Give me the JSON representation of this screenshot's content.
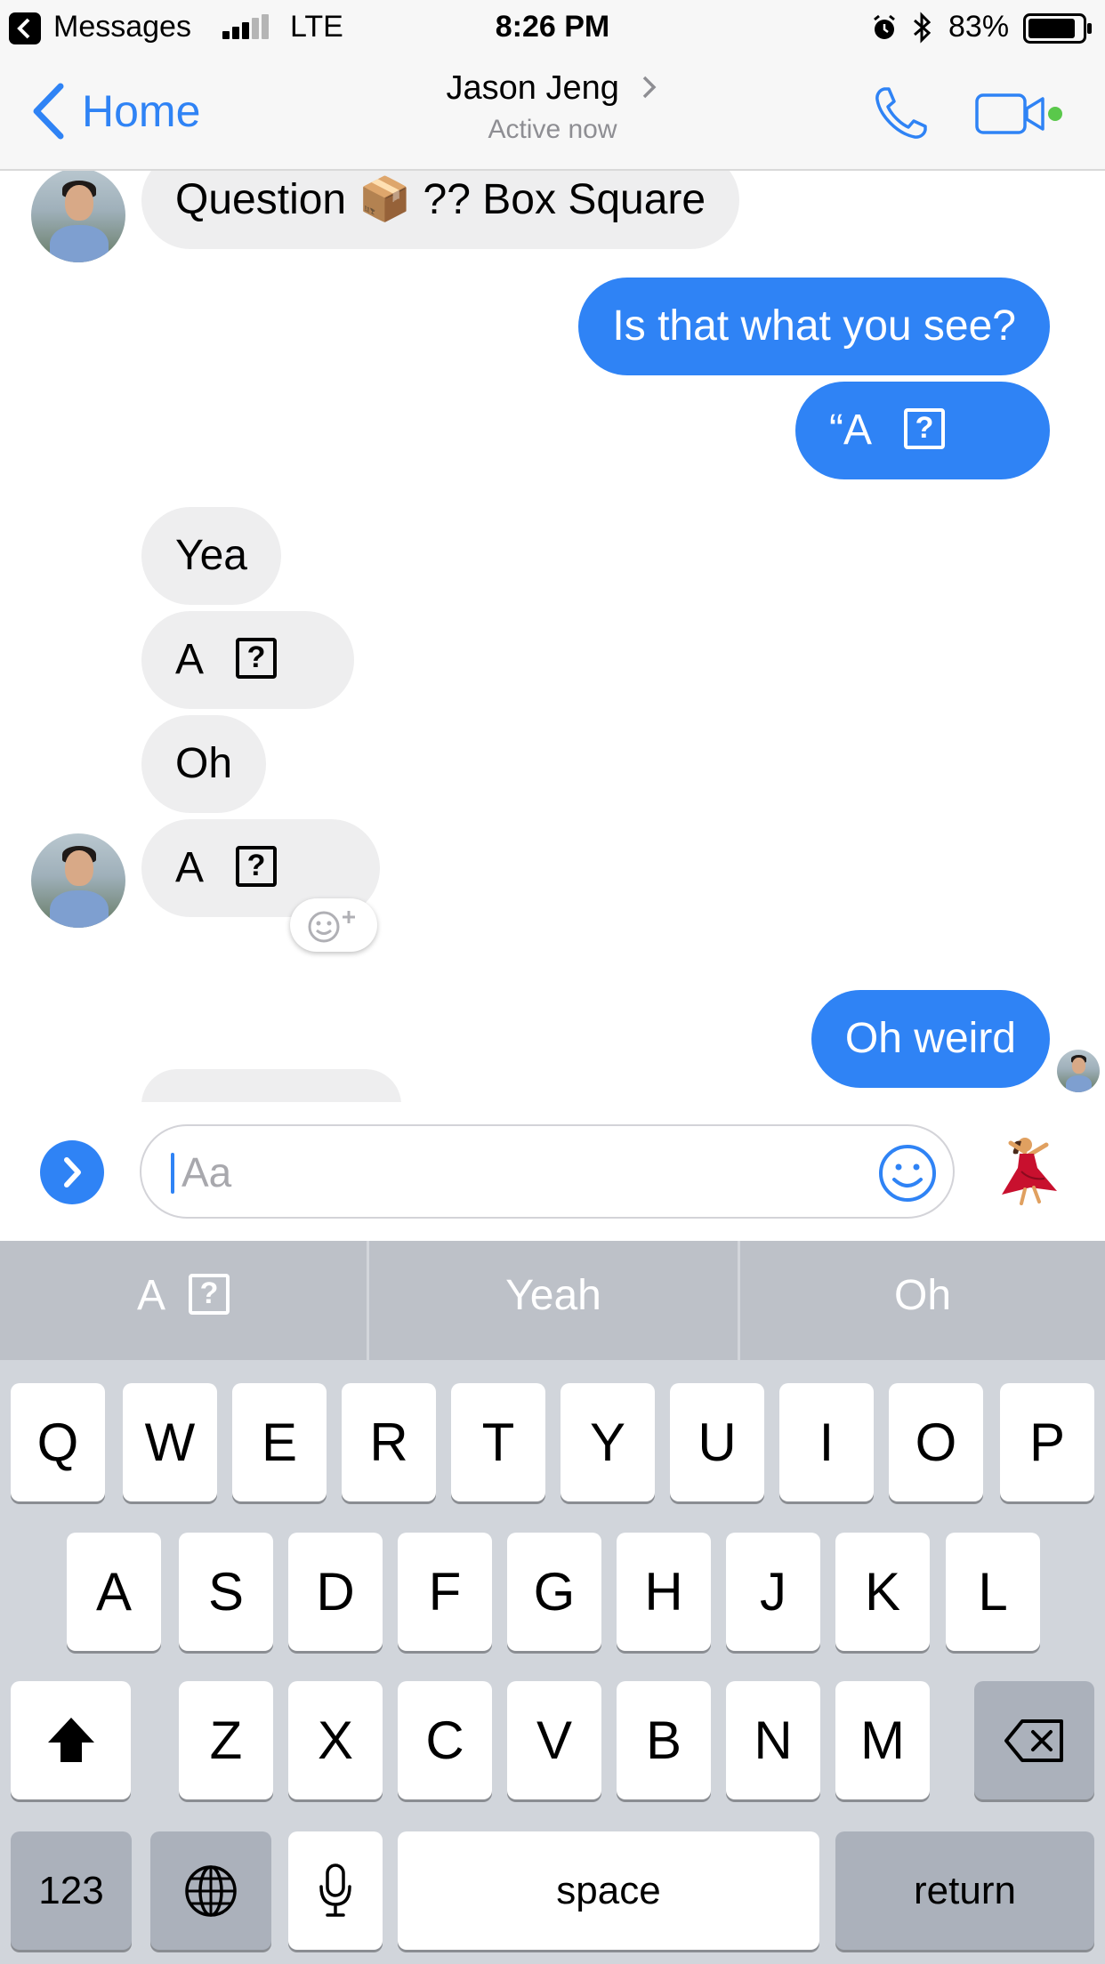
{
  "status_bar": {
    "app": "Messages",
    "network": "LTE",
    "time": "8:26 PM",
    "battery": "83%"
  },
  "header": {
    "back_label": "Home",
    "name": "Jason Jeng",
    "status": "Active now",
    "accent": "#2f83f5"
  },
  "messages": [
    {
      "side": "in",
      "text": "Question 📦 ?? Box Square"
    },
    {
      "side": "out",
      "text": "Is that what you see?"
    },
    {
      "side": "out",
      "text": "“A",
      "box": "?"
    },
    {
      "side": "in",
      "text": "Yea"
    },
    {
      "side": "in",
      "text": "A",
      "box": "?"
    },
    {
      "side": "in",
      "text": "Oh"
    },
    {
      "side": "in",
      "text": "A",
      "box": "?"
    },
    {
      "side": "out",
      "text": "Oh weird"
    }
  ],
  "composer": {
    "placeholder": "Aa"
  },
  "keyboard": {
    "suggestions": [
      {
        "text": "A",
        "box": "?"
      },
      {
        "text": "Yeah"
      },
      {
        "text": "Oh"
      }
    ],
    "row1": [
      "Q",
      "W",
      "E",
      "R",
      "T",
      "Y",
      "U",
      "I",
      "O",
      "P"
    ],
    "row2": [
      "A",
      "S",
      "D",
      "F",
      "G",
      "H",
      "J",
      "K",
      "L"
    ],
    "row3": [
      "Z",
      "X",
      "C",
      "V",
      "B",
      "N",
      "M"
    ],
    "numbers_label": "123",
    "space_label": "space",
    "return_label": "return"
  }
}
